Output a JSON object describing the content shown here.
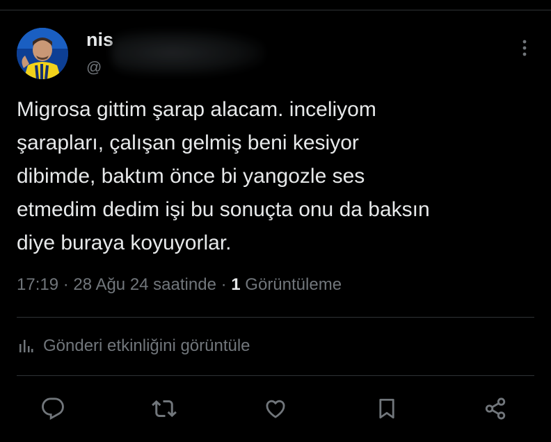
{
  "author": {
    "name": "nis",
    "handle": "@"
  },
  "tweet": {
    "text": "Migrosa gittim şarap alacam. inceliyom\nşarapları, çalışan gelmiş beni kesiyor\ndibimde, baktım önce bi yangozle ses\netmedim dedim işi bu sonuçta onu da baksın\ndiye buraya koyuyorlar."
  },
  "meta": {
    "time": "17:19",
    "separator": "·",
    "date": "28 Ağu 24 saatinde",
    "views_count": "1",
    "views_label": "Görüntüleme"
  },
  "activity": {
    "label": "Gönderi etkinliğini görüntüle"
  },
  "icons": {
    "more": "more-vertical-icon",
    "activity": "analytics-bars-icon",
    "reply": "reply-bubble-icon",
    "retweet": "retweet-icon",
    "like": "heart-icon",
    "bookmark": "bookmark-icon",
    "share": "share-icon"
  },
  "colors": {
    "background": "#000000",
    "text_primary": "#e7e9ea",
    "text_secondary": "#71767b",
    "divider": "#2f3336"
  }
}
